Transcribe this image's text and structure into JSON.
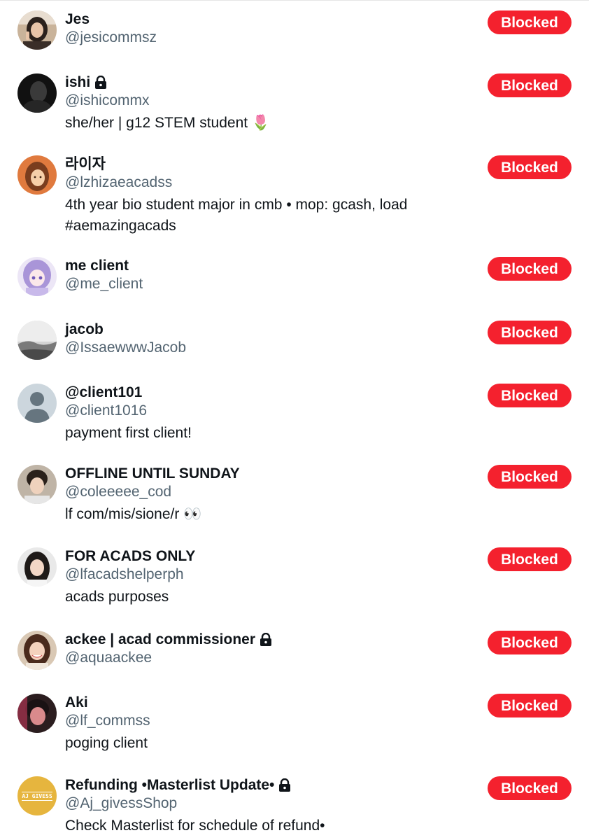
{
  "blocked_list": {
    "button_label": "Blocked",
    "accent_color": "#f4212e",
    "accounts": [
      {
        "name": "Jes",
        "handle": "@jesicommsz",
        "bio": "",
        "protected": false,
        "avatar": "photo-woman-peace-sign"
      },
      {
        "name": "ishi",
        "handle": "@ishicommx",
        "bio": "she/her | g12 STEM student 🌷",
        "protected": true,
        "avatar": "photo-dark-silhouette"
      },
      {
        "name": "라이자",
        "handle": "@lzhizaeacadss",
        "bio": "4th year bio student major in cmb • mop: gcash, load #aemazingacads",
        "protected": false,
        "avatar": "illustration-girl-orange"
      },
      {
        "name": "me client",
        "handle": "@me_client",
        "bio": "",
        "protected": false,
        "avatar": "anime-girl-purple"
      },
      {
        "name": "jacob",
        "handle": "@IssaewwwJacob",
        "bio": "",
        "protected": false,
        "avatar": "photo-grayscale-landscape"
      },
      {
        "name": "@client101",
        "handle": "@client1016",
        "bio": "payment first client!",
        "protected": false,
        "avatar": "default-avatar"
      },
      {
        "name": "OFFLINE UNTIL SUNDAY",
        "handle": "@coleeeee_cod",
        "bio": "lf com/mis/sione/r 👀",
        "protected": false,
        "avatar": "photo-young-man"
      },
      {
        "name": "FOR ACADS ONLY",
        "handle": "@lfacadshelperph",
        "bio": "acads purposes",
        "protected": false,
        "avatar": "photo-woman-long-hair"
      },
      {
        "name": "ackee | acad commissioner",
        "handle": "@aquaackee",
        "bio": "",
        "protected": true,
        "avatar": "photo-woman-smiling"
      },
      {
        "name": "Aki",
        "handle": "@lf_commss",
        "bio": "poging client",
        "protected": false,
        "avatar": "photo-person-red-light"
      },
      {
        "name": "Refunding •Masterlist Update•",
        "handle": "@Aj_givessShop",
        "bio": "Check Masterlist for schedule of refund•",
        "protected": true,
        "avatar": "logo-aj-givess-gold",
        "avatar_text": "AJ GIVESS"
      }
    ]
  }
}
